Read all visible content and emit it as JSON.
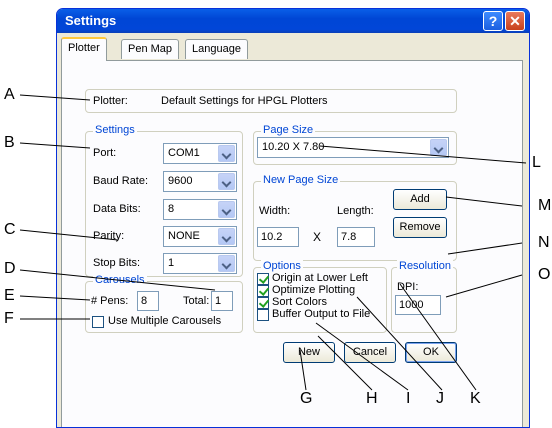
{
  "window": {
    "title": "Settings",
    "help_label": "?",
    "close_label": "✕"
  },
  "tabs": [
    "Plotter",
    "Pen Map",
    "Language"
  ],
  "plotter": {
    "label": "Plotter:",
    "value": "Default Settings for HPGL Plotters"
  },
  "settings": {
    "title": "Settings",
    "port": {
      "label": "Port:",
      "value": "COM1"
    },
    "baud_rate": {
      "label": "Baud Rate:",
      "value": "9600"
    },
    "data_bits": {
      "label": "Data Bits:",
      "value": "8"
    },
    "parity": {
      "label": "Parity:",
      "value": "NONE"
    },
    "stop_bits": {
      "label": "Stop Bits:",
      "value": "1"
    }
  },
  "carousels": {
    "title": "Carousels",
    "pens_label": "# Pens:",
    "pens_value": "8",
    "total_label": "Total:",
    "total_value": "1",
    "multiple_label": "Use Multiple Carousels"
  },
  "page_size": {
    "title": "Page Size",
    "value": "10.20 X 7.80"
  },
  "new_page_size": {
    "title": "New Page Size",
    "width_label": "Width:",
    "length_label": "Length:",
    "width_value": "10.2",
    "times": "X",
    "length_value": "7.8",
    "add_label": "Add",
    "remove_label": "Remove"
  },
  "options": {
    "title": "Options",
    "items": [
      {
        "label": "Origin at Lower Left",
        "checked": true
      },
      {
        "label": "Optimize Plotting",
        "checked": true
      },
      {
        "label": "Sort Colors",
        "checked": true
      },
      {
        "label": "Buffer Output to File",
        "checked": false
      }
    ]
  },
  "resolution": {
    "title": "Resolution",
    "dpi_label": "DPI:",
    "dpi_value": "1000"
  },
  "buttons": {
    "new": "New",
    "cancel": "Cancel",
    "ok": "OK"
  },
  "callouts": [
    "A",
    "B",
    "C",
    "D",
    "E",
    "F",
    "G",
    "H",
    "I",
    "J",
    "K",
    "L",
    "M",
    "N",
    "O"
  ]
}
